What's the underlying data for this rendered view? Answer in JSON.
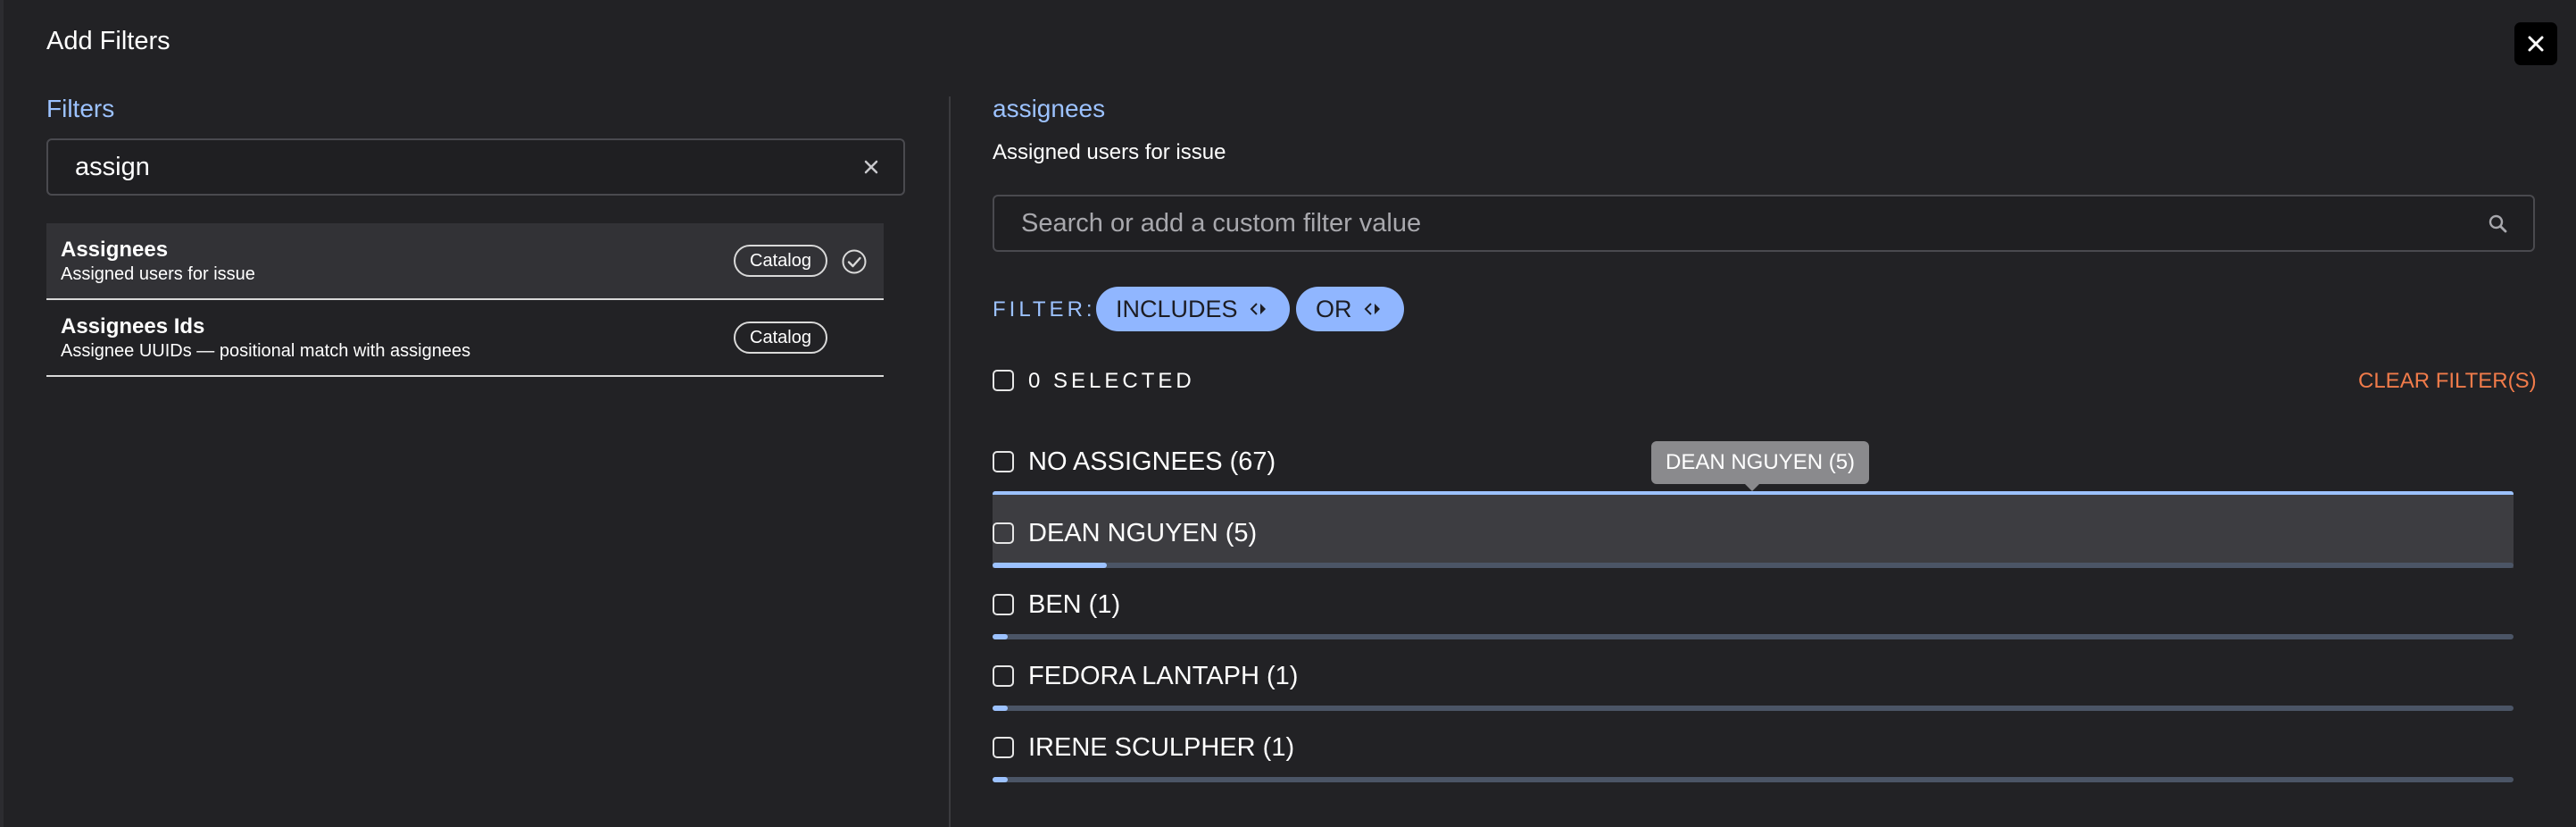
{
  "dialog": {
    "title": "Add Filters",
    "close_icon": "close-icon"
  },
  "left_panel": {
    "heading": "Filters",
    "search": {
      "value": "assign",
      "clear_icon": "clear-x-icon"
    },
    "results": [
      {
        "name": "Assignees",
        "description": "Assigned users for issue",
        "badge": "Catalog",
        "selected": true
      },
      {
        "name": "Assignees Ids",
        "description": "Assignee UUIDs — positional match with assignees",
        "badge": "Catalog",
        "selected": false
      }
    ]
  },
  "right_panel": {
    "heading": "assignees",
    "description": "Assigned users for issue",
    "search": {
      "placeholder": "Search or add a custom filter value",
      "icon": "search-icon"
    },
    "filter_label": "FILTER:",
    "match_pill": "INCLUDES",
    "logic_pill": "OR",
    "selected_count_label": "0 SELECTED",
    "clear_label": "CLEAR FILTER(S)",
    "options": [
      {
        "label": "NO ASSIGNEES (67)",
        "fraction": 1.0
      },
      {
        "label": "DEAN NGUYEN (5)",
        "fraction": 0.075
      },
      {
        "label": "BEN (1)",
        "fraction": 0.01
      },
      {
        "label": "FEDORA LANTAPH (1)",
        "fraction": 0.01
      },
      {
        "label": "IRENE SCULPHER (1)",
        "fraction": 0.01
      }
    ],
    "tooltip": "DEAN NGUYEN (5)"
  },
  "colors": {
    "background": "#222225",
    "accent": "#9cc2ff",
    "pill": "#90b6ff",
    "clear": "#f07b4a",
    "bar_track": "#4b5566"
  }
}
